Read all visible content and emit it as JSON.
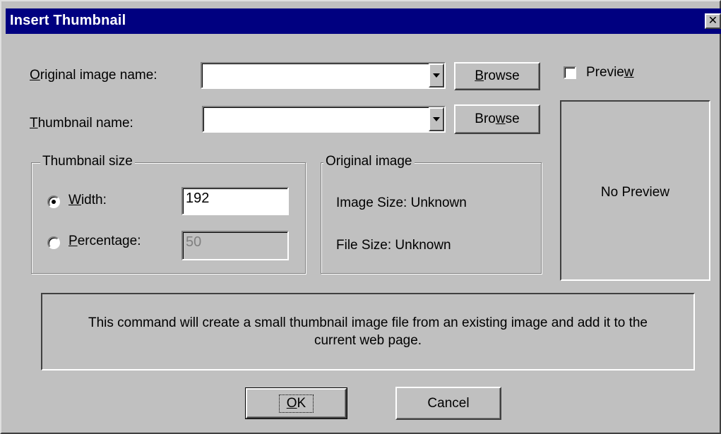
{
  "window": {
    "title": "Insert Thumbnail",
    "close_glyph": "✕",
    "colors": {
      "title_bar": "#000080",
      "face": "#c0c0c0"
    }
  },
  "original_image": {
    "label_prefix": "",
    "label_mnemonic": "O",
    "label_rest": "riginal image name:",
    "value": "",
    "browse": {
      "pre": "",
      "mn": "B",
      "post": "rowse"
    }
  },
  "thumbnail": {
    "label_prefix": "",
    "label_mnemonic": "T",
    "label_rest": "humbnail name:",
    "value": "",
    "browse": {
      "pre": "Bro",
      "mn": "w",
      "post": "se"
    }
  },
  "preview": {
    "checkbox": {
      "pre": "Previe",
      "mn": "w",
      "post": "",
      "checked": false
    },
    "empty_text": "No Preview"
  },
  "thumbnail_size": {
    "title": "Thumbnail size",
    "width_option": {
      "pre": "",
      "mn": "W",
      "post": "idth:",
      "selected": true,
      "value": "192"
    },
    "percentage_option": {
      "pre": "",
      "mn": "P",
      "post": "ercentage:",
      "selected": false,
      "value": "50"
    }
  },
  "original_info": {
    "title": "Original image",
    "image_size": "Image Size: Unknown",
    "file_size": "File Size: Unknown"
  },
  "description": {
    "line1": "This command will create a small thumbnail image file from an existing image and add it to the",
    "line2": "current web page."
  },
  "buttons": {
    "ok": {
      "pre": "",
      "mn": "O",
      "post": "K"
    },
    "cancel": "Cancel"
  },
  "icons": {
    "close": "close-icon",
    "dropdown": "chevron-down-icon",
    "radio": "radio-dot-icon"
  }
}
